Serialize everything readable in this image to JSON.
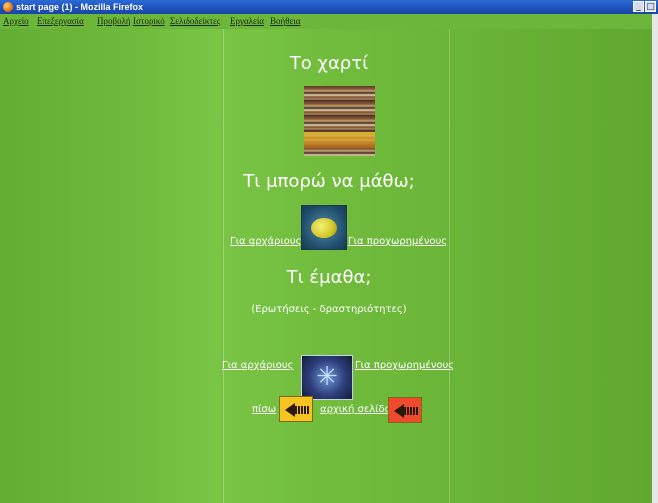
{
  "window": {
    "title": "start page (1) - Mozilla Firefox",
    "controls": {
      "minimize": "_",
      "maximize": "□"
    }
  },
  "menu": {
    "items": [
      "Αρχείο",
      "Επεξεργασία",
      "Προβολή",
      "Ιστορικό",
      "Σελιδοδείκτες",
      "Εργαλεία",
      "Βοήθεια"
    ]
  },
  "page": {
    "title": "Το χαρτί",
    "learn_heading": "Τι μπορώ να μάθω;",
    "learn_links": {
      "beginners": "Για αρχάριους",
      "advanced": "Για προχωρημένους"
    },
    "learned_heading": "Τι έμαθα;",
    "learned_subtitle": "(Ερωτήσεις - δραστηριότητες)",
    "learned_links": {
      "beginners": "Για αρχάριους",
      "advanced": "Για προχωρημένους"
    },
    "nav": {
      "back": "πίσω",
      "home": "αρχική σελίδα"
    }
  },
  "colors": {
    "background": "#6cb63a",
    "titlebar": "#1d50b8",
    "text": "#ffffff",
    "back_button": "#f6c321",
    "home_button": "#f04a2e"
  },
  "icons": {
    "paper_image": "paper-stack-image",
    "learn_image": "yellow-fish-image",
    "learned_image": "star-burst-image",
    "back_icon": "arrow-left-icon",
    "home_icon": "arrow-left-icon"
  }
}
